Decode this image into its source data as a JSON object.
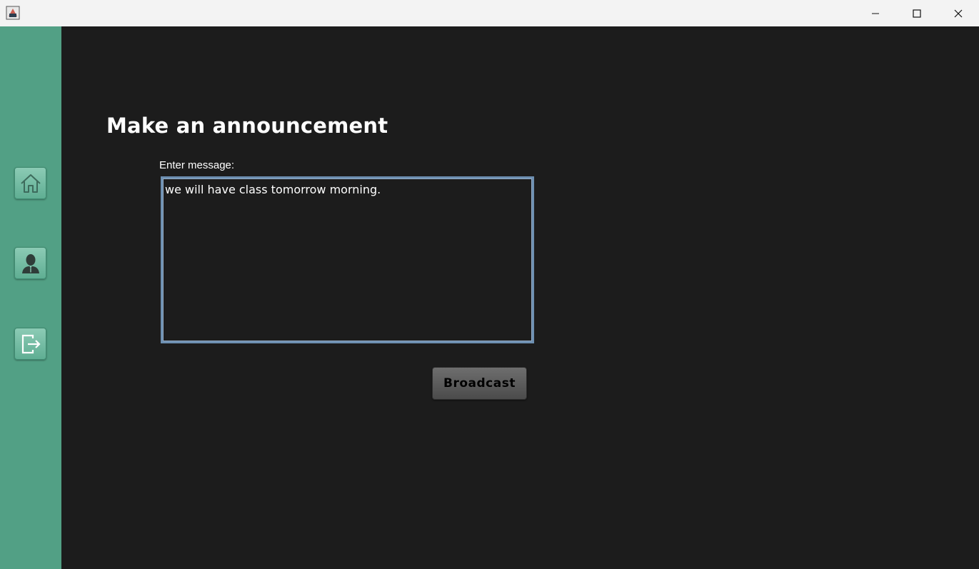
{
  "window": {
    "icon": "java-app-icon",
    "controls": {
      "minimize": "minimize-icon",
      "maximize": "maximize-icon",
      "close": "close-icon"
    }
  },
  "sidebar": {
    "background": "#52a085",
    "items": [
      {
        "icon": "home-icon"
      },
      {
        "icon": "user-icon"
      },
      {
        "icon": "logout-icon"
      }
    ]
  },
  "main": {
    "title": "Make an announcement",
    "message_label": "Enter message:",
    "message_value": "we will have class tomorrow morning.",
    "broadcast_label": "Broadcast"
  },
  "colors": {
    "background": "#1c1c1c",
    "accent": "#52a085",
    "field_border": "#6d8fb1"
  }
}
